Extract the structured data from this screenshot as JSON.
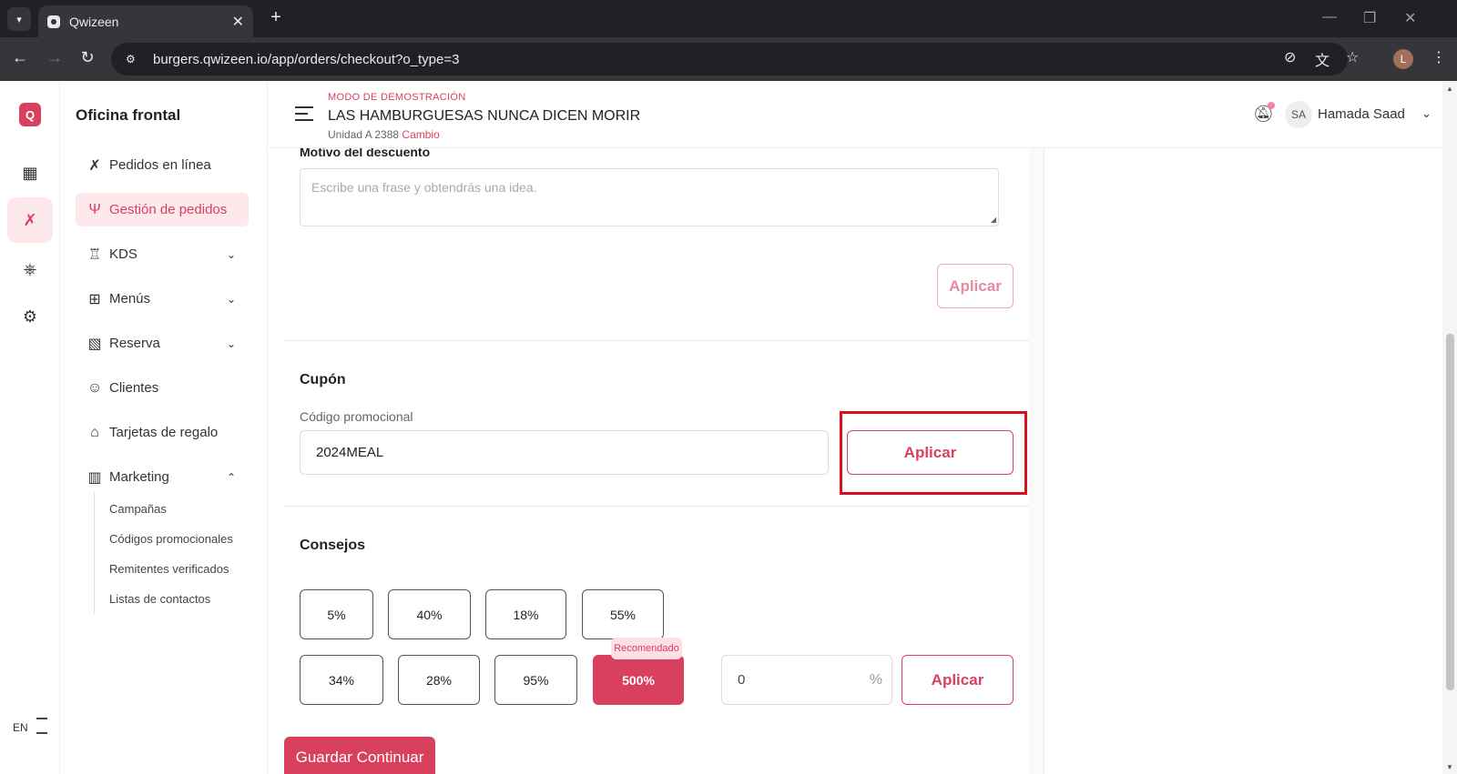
{
  "browser": {
    "tab_title": "Qwizeen",
    "url": "burgers.qwizeen.io/app/orders/checkout?o_type=3",
    "profile_initial": "L"
  },
  "rail": {
    "logo_letter": "Q",
    "language": "EN"
  },
  "sidebar": {
    "title": "Oficina frontal",
    "items": [
      {
        "label": "Pedidos en línea",
        "icon": "utensils-cross-icon"
      },
      {
        "label": "Gestión de pedidos",
        "icon": "fork-knife-icon"
      },
      {
        "label": "KDS",
        "icon": "chef-hat-icon"
      },
      {
        "label": "Menús",
        "icon": "grid-icon"
      },
      {
        "label": "Reserva",
        "icon": "table-icon"
      },
      {
        "label": "Clientes",
        "icon": "users-icon"
      },
      {
        "label": "Tarjetas de regalo",
        "icon": "gift-icon"
      },
      {
        "label": "Marketing",
        "icon": "bar-chart-icon"
      }
    ],
    "marketing_sub": [
      "Campañas",
      "Códigos promocionales",
      "Remitentes verificados",
      "Listas de contactos"
    ]
  },
  "header": {
    "demo_mode": "MODO DE DEMOSTRACIÓN",
    "store_name": "LAS HAMBURGUESAS NUNCA DICEN MORIR",
    "unit": "Unidad A 2388",
    "change": "Cambio",
    "avatar_initials": "SA",
    "user_name": "Hamada Saad"
  },
  "discount": {
    "reason_label": "Motivo del descuento",
    "reason_placeholder": "Escribe una frase y obtendrás una idea.",
    "apply_label": "Aplicar"
  },
  "coupon": {
    "title": "Cupón",
    "field_label": "Código promocional",
    "value": "2024MEAL",
    "apply_label": "Aplicar"
  },
  "tips": {
    "title": "Consejos",
    "row1": [
      "5%",
      "40%",
      "18%",
      "55%"
    ],
    "row2": [
      "34%",
      "28%",
      "95%",
      "500%"
    ],
    "recommended_label": "Recomendado",
    "selected": "500%",
    "custom_value": "0",
    "percent_symbol": "%",
    "apply_label": "Aplicar"
  },
  "footer": {
    "save_continue": "Guardar Continuar"
  },
  "colors": {
    "accent": "#d9405e",
    "highlight_box": "#d9101e"
  }
}
